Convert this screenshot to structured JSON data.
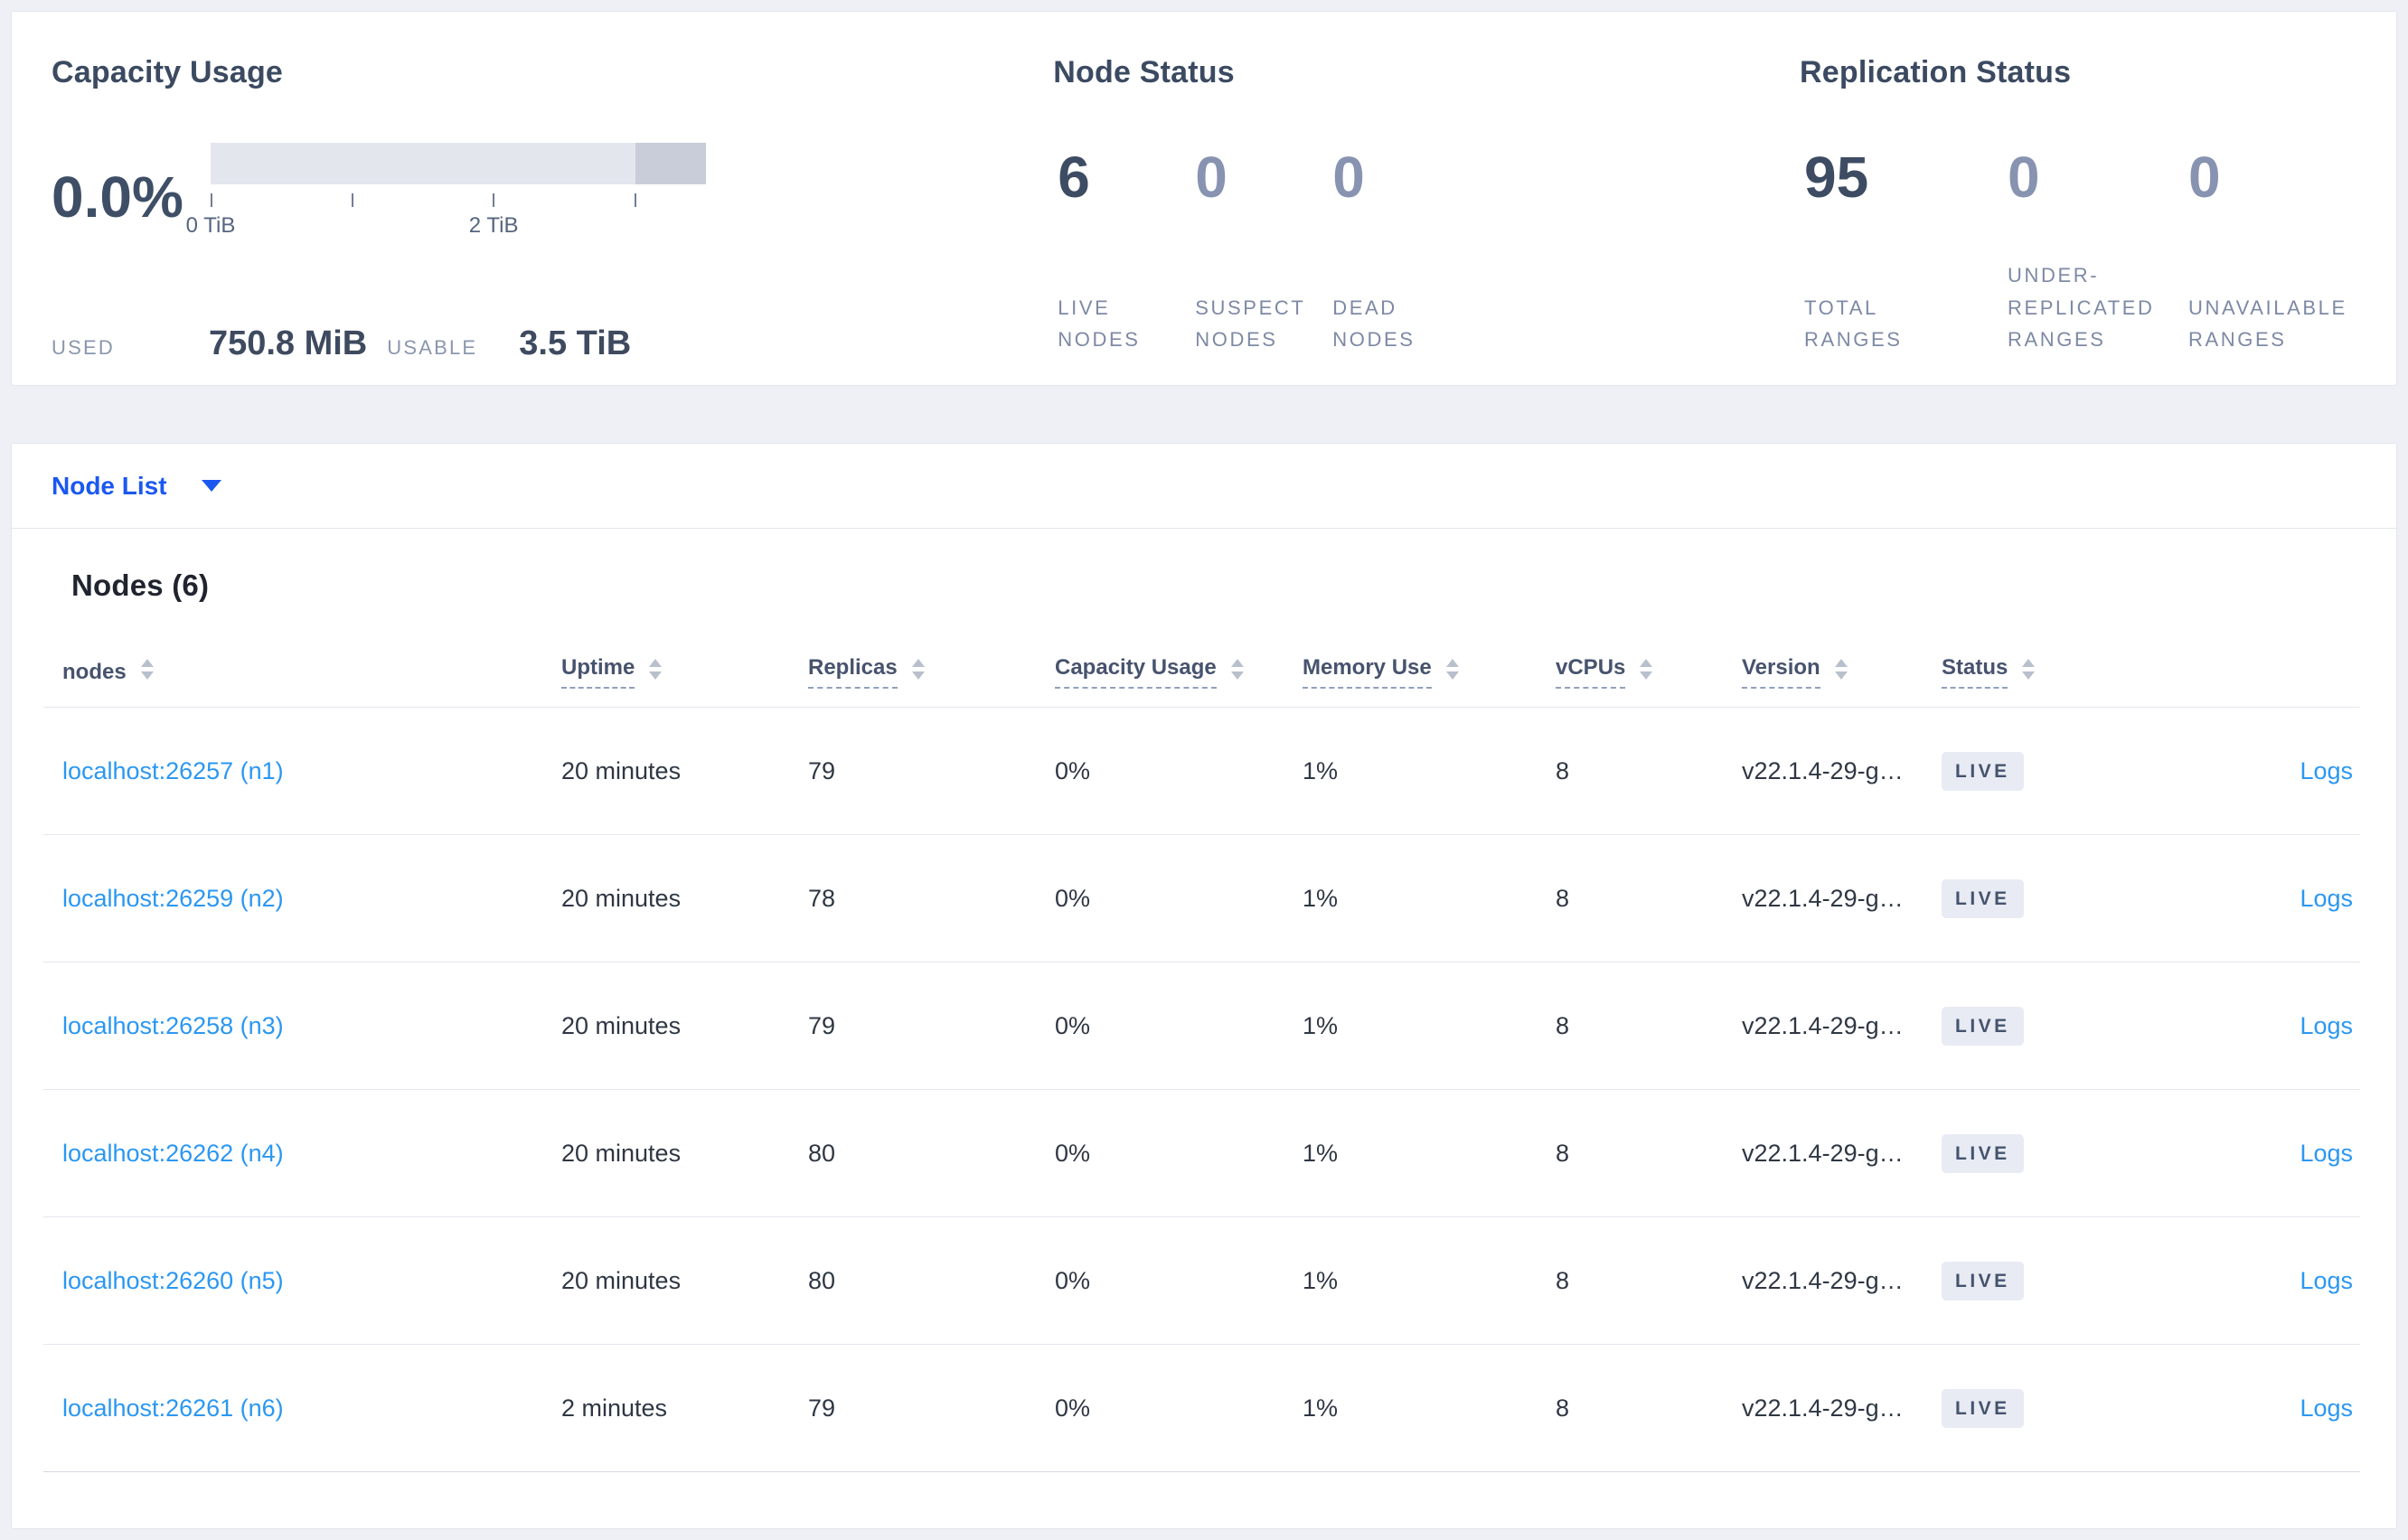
{
  "summary": {
    "capacity": {
      "title": "Capacity Usage",
      "percent_used": "0.0%",
      "used_label": "USED",
      "used_value": "750.8 MiB",
      "usable_label": "USABLE",
      "usable_value": "3.5 TiB",
      "bar": {
        "range_tib": [
          0,
          3.5
        ],
        "light_segment_tib": [
          0,
          3.0
        ],
        "dark_segment_tib": [
          3.0,
          3.5
        ],
        "ticks_tib": [
          0,
          1,
          2,
          3
        ],
        "tick_labels": [
          {
            "tib": 0,
            "label": "0 TiB"
          },
          {
            "tib": 2,
            "label": "2 TiB"
          }
        ],
        "light_color": "#e3e6ed",
        "dark_color": "#c8cdd9"
      }
    },
    "node_status": {
      "title": "Node Status",
      "metrics": [
        {
          "value": "6",
          "label": "LIVE NODES",
          "emph": true
        },
        {
          "value": "0",
          "label": "SUSPECT NODES",
          "emph": false
        },
        {
          "value": "0",
          "label": "DEAD NODES",
          "emph": false
        }
      ]
    },
    "replication": {
      "title": "Replication Status",
      "metrics": [
        {
          "value": "95",
          "label": "TOTAL RANGES",
          "emph": true
        },
        {
          "value": "0",
          "label": "UNDER-REPLICATED RANGES",
          "emph": false
        },
        {
          "value": "0",
          "label": "UNAVAILABLE RANGES",
          "emph": false
        }
      ]
    }
  },
  "node_list": {
    "label": "Node List"
  },
  "table": {
    "title": "Nodes (6)",
    "columns": [
      {
        "label": "nodes",
        "underlined": false
      },
      {
        "label": "Uptime",
        "underlined": true
      },
      {
        "label": "Replicas",
        "underlined": true
      },
      {
        "label": "Capacity Usage",
        "underlined": true
      },
      {
        "label": "Memory Use",
        "underlined": true
      },
      {
        "label": "vCPUs",
        "underlined": true
      },
      {
        "label": "Version",
        "underlined": true
      },
      {
        "label": "Status",
        "underlined": true
      }
    ],
    "rows": [
      {
        "node": "localhost:26257 (n1)",
        "uptime": "20 minutes",
        "replicas": "79",
        "capacity": "0%",
        "memory": "1%",
        "vcpus": "8",
        "version": "v22.1.4-29-g…",
        "status": "LIVE",
        "logs": "Logs"
      },
      {
        "node": "localhost:26259 (n2)",
        "uptime": "20 minutes",
        "replicas": "78",
        "capacity": "0%",
        "memory": "1%",
        "vcpus": "8",
        "version": "v22.1.4-29-g…",
        "status": "LIVE",
        "logs": "Logs"
      },
      {
        "node": "localhost:26258 (n3)",
        "uptime": "20 minutes",
        "replicas": "79",
        "capacity": "0%",
        "memory": "1%",
        "vcpus": "8",
        "version": "v22.1.4-29-g…",
        "status": "LIVE",
        "logs": "Logs"
      },
      {
        "node": "localhost:26262 (n4)",
        "uptime": "20 minutes",
        "replicas": "80",
        "capacity": "0%",
        "memory": "1%",
        "vcpus": "8",
        "version": "v22.1.4-29-g…",
        "status": "LIVE",
        "logs": "Logs"
      },
      {
        "node": "localhost:26260 (n5)",
        "uptime": "20 minutes",
        "replicas": "80",
        "capacity": "0%",
        "memory": "1%",
        "vcpus": "8",
        "version": "v22.1.4-29-g…",
        "status": "LIVE",
        "logs": "Logs"
      },
      {
        "node": "localhost:26261 (n6)",
        "uptime": "2 minutes",
        "replicas": "79",
        "capacity": "0%",
        "memory": "1%",
        "vcpus": "8",
        "version": "v22.1.4-29-g…",
        "status": "LIVE",
        "logs": "Logs"
      }
    ]
  },
  "colors": {
    "accent_blue": "#1a58f0",
    "link_blue": "#2b97f2",
    "dark_slate": "#3e4e66",
    "muted_slate": "#8793b0",
    "badge_bg": "#e8ebf3"
  }
}
